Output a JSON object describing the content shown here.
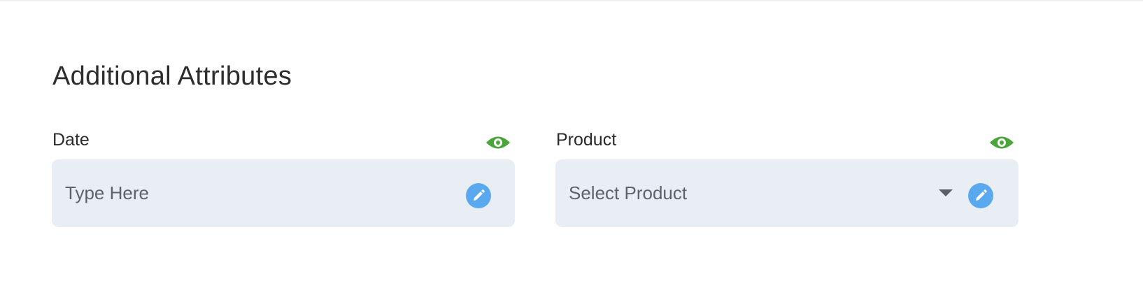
{
  "section": {
    "title": "Additional Attributes"
  },
  "fields": {
    "date": {
      "label": "Date",
      "placeholder": "Type Here",
      "visibility_icon": "eye-icon",
      "action_icon": "pencil-icon"
    },
    "product": {
      "label": "Product",
      "selected_value": "Select Product",
      "visibility_icon": "eye-icon",
      "dropdown_icon": "caret-down-icon",
      "action_icon": "pencil-icon"
    }
  },
  "colors": {
    "input_background": "#e9edf4",
    "visibility_icon": "#4aa63a",
    "edit_button": "#5aa9ef"
  }
}
